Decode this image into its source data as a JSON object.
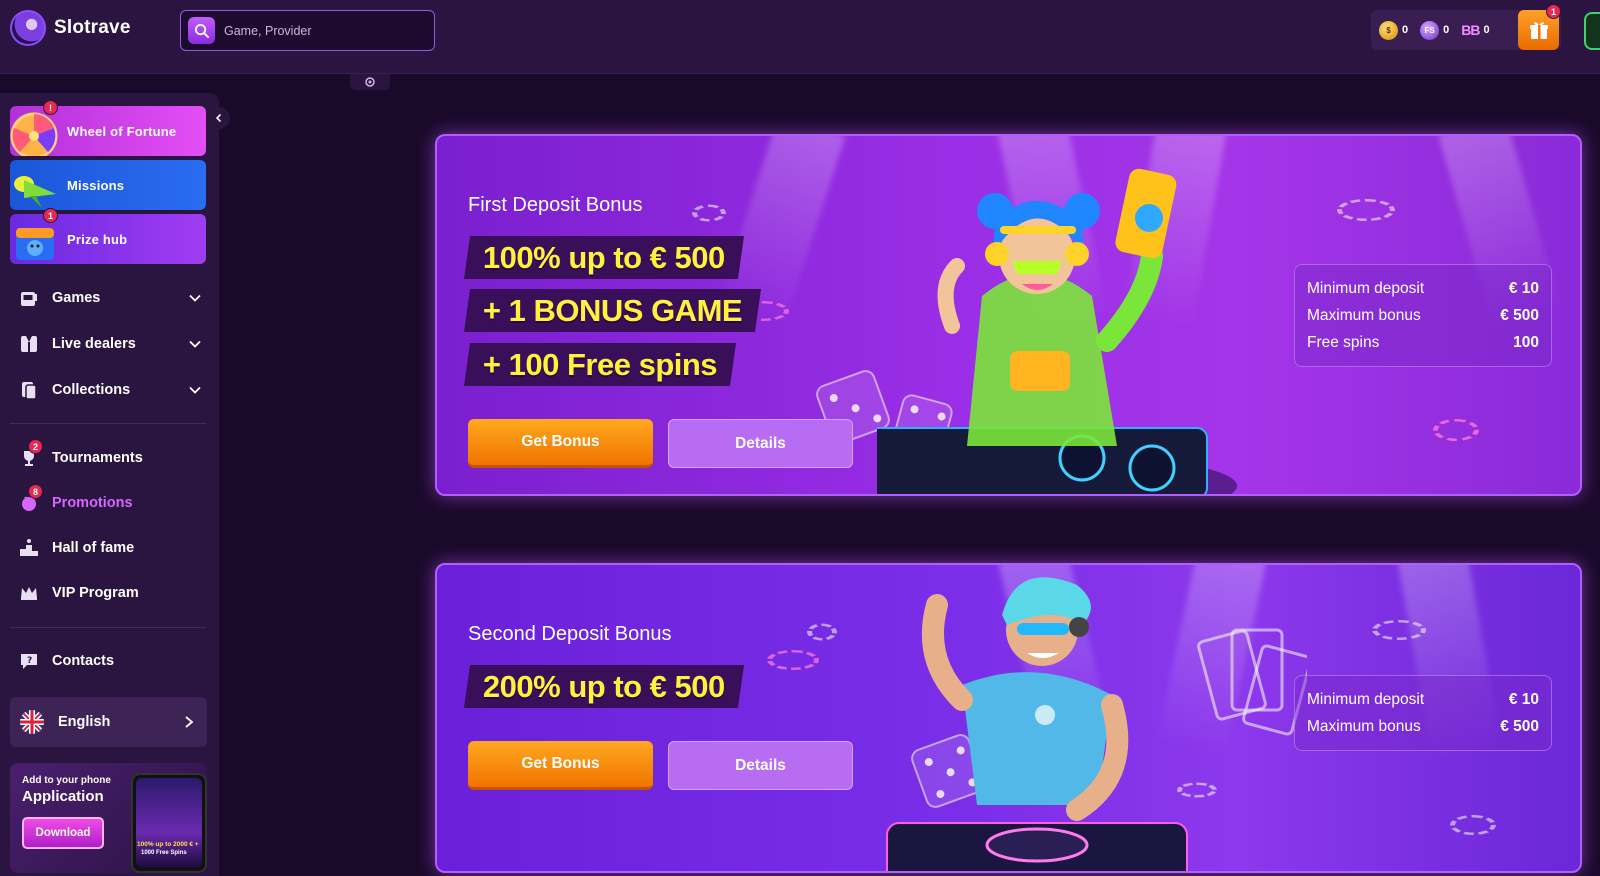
{
  "header": {
    "logo_text": "Slotrave",
    "search": {
      "placeholder": "Game, Provider"
    },
    "wallets": [
      {
        "icon": "gold-coin-icon",
        "value": "0"
      },
      {
        "icon": "freespins-coin-icon",
        "value": "0",
        "label": "FS"
      },
      {
        "icon": "bonus-balance-icon",
        "value": "0",
        "label": "BB"
      }
    ],
    "gift_badge": "1"
  },
  "sidebar": {
    "promo_tiles": [
      {
        "label": "Wheel of Fortune",
        "badge": "!"
      },
      {
        "label": "Missions"
      },
      {
        "label": "Prize hub",
        "badge": "1"
      }
    ],
    "nav": [
      {
        "label": "Games",
        "icon": "slot-machine-icon"
      },
      {
        "label": "Live dealers",
        "icon": "dealer-icon"
      },
      {
        "label": "Collections",
        "icon": "cards-icon"
      },
      {
        "label": "Tournaments",
        "icon": "trophy-icon",
        "badge": "2"
      },
      {
        "label": "Promotions",
        "icon": "promo-icon",
        "badge": "8"
      },
      {
        "label": "Hall of fame",
        "icon": "podium-icon"
      },
      {
        "label": "VIP Program",
        "icon": "crown-icon"
      },
      {
        "label": "Contacts",
        "icon": "chat-icon"
      }
    ],
    "language": "English",
    "app_card": {
      "small": "Add to your phone",
      "big": "Application",
      "button": "Download",
      "phone_line1": "100% up to 2000 € +",
      "phone_line2": "1000 Free Spins"
    }
  },
  "banners": [
    {
      "title": "First Deposit Bonus",
      "lines": [
        "100% up to € 500",
        "+ 1 BONUS GAME",
        "+ 100 Free spins"
      ],
      "get_label": "Get Bonus",
      "details_label": "Details",
      "info": [
        {
          "k": "Minimum deposit",
          "v": "€ 10"
        },
        {
          "k": "Maximum bonus",
          "v": "€ 500"
        },
        {
          "k": "Free spins",
          "v": "100"
        }
      ]
    },
    {
      "title": "Second Deposit Bonus",
      "lines": [
        "200% up to € 500"
      ],
      "get_label": "Get Bonus",
      "details_label": "Details",
      "info": [
        {
          "k": "Minimum deposit",
          "v": "€ 10"
        },
        {
          "k": "Maximum bonus",
          "v": "€ 500"
        }
      ]
    }
  ],
  "colors": {
    "background": "#1a0a2a",
    "header": "#2b1440",
    "accent_orange": "#f07400",
    "accent_purple": "#b35cff",
    "headline_yellow": "#fff23a",
    "active_nav": "#d766ff"
  }
}
